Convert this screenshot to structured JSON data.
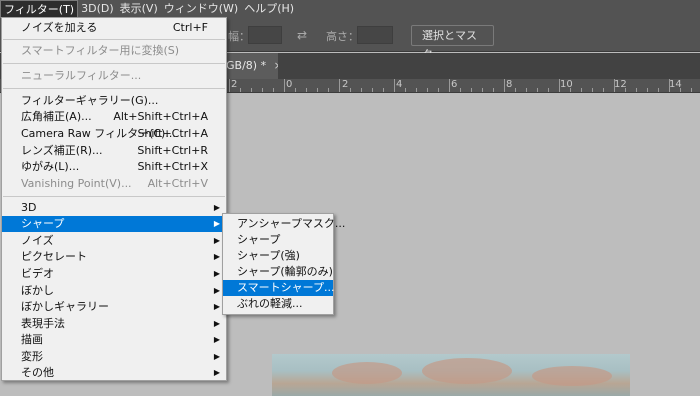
{
  "menubar": {
    "items": [
      {
        "label": "フィルター(T)",
        "active": true
      },
      {
        "label": "3D(D)",
        "active": false
      },
      {
        "label": "表示(V)",
        "active": false
      },
      {
        "label": "ウィンドウ(W)",
        "active": false
      },
      {
        "label": "ヘルプ(H)",
        "active": false
      }
    ]
  },
  "options_bar": {
    "width_label": "幅：",
    "height_label": "高さ：",
    "swap_icon": "swap-icon",
    "select_mask_button": "選択とマスク..."
  },
  "document_tab": {
    "title": "GB/8) *",
    "close_glyph": "×"
  },
  "ruler": {
    "numbers": [
      "2",
      "0",
      "2",
      "4",
      "6",
      "8",
      "10",
      "12",
      "14"
    ]
  },
  "filter_menu": {
    "items": [
      {
        "label": "ノイズを加える",
        "shortcut": "Ctrl+F",
        "disabled": false
      },
      {
        "label": "スマートフィルター用に変換(S)",
        "shortcut": "",
        "disabled": true
      },
      {
        "label": "ニューラルフィルター...",
        "shortcut": "",
        "disabled": true
      },
      {
        "label": "フィルターギャラリー(G)...",
        "shortcut": "",
        "disabled": false
      },
      {
        "label": "広角補正(A)...",
        "shortcut": "Alt+Shift+Ctrl+A",
        "disabled": false
      },
      {
        "label": "Camera Raw フィルター(C)...",
        "shortcut": "Shift+Ctrl+A",
        "disabled": false
      },
      {
        "label": "レンズ補正(R)...",
        "shortcut": "Shift+Ctrl+R",
        "disabled": false
      },
      {
        "label": "ゆがみ(L)...",
        "shortcut": "Shift+Ctrl+X",
        "disabled": false
      },
      {
        "label": "Vanishing Point(V)...",
        "shortcut": "Alt+Ctrl+V",
        "disabled": true
      },
      {
        "label": "3D",
        "submenu": true
      },
      {
        "label": "シャープ",
        "submenu": true,
        "highlighted": true
      },
      {
        "label": "ノイズ",
        "submenu": true
      },
      {
        "label": "ピクセレート",
        "submenu": true
      },
      {
        "label": "ビデオ",
        "submenu": true
      },
      {
        "label": "ぼかし",
        "submenu": true
      },
      {
        "label": "ぼかしギャラリー",
        "submenu": true
      },
      {
        "label": "表現手法",
        "submenu": true
      },
      {
        "label": "描画",
        "submenu": true
      },
      {
        "label": "変形",
        "submenu": true
      },
      {
        "label": "その他",
        "submenu": true
      }
    ]
  },
  "sharpen_submenu": {
    "items": [
      {
        "label": "アンシャープマスク..."
      },
      {
        "label": "シャープ"
      },
      {
        "label": "シャープ(強)"
      },
      {
        "label": "シャープ(輪郭のみ)"
      },
      {
        "label": "スマートシャープ...",
        "highlighted": true
      },
      {
        "label": "ぶれの軽減..."
      }
    ]
  },
  "colors": {
    "highlight": "#0078d7",
    "menu_background": "#f0f0f0",
    "app_chrome": "#535353",
    "canvas_background": "#bdbdbd"
  }
}
